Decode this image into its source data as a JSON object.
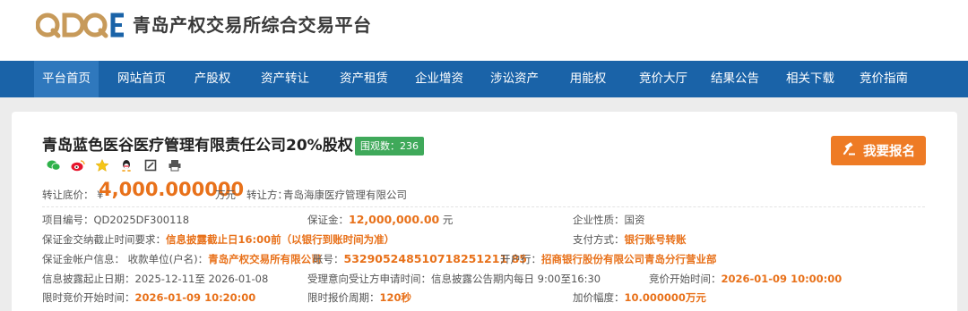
{
  "header": {
    "logo_text": "QDQE",
    "site_title": "青岛产权交易所综合交易平台"
  },
  "colors": {
    "nav_bg": "#1a63a8",
    "nav_active": "#2f78bd",
    "accent": "#ee7b25",
    "badge": "#3fa95a",
    "logo_gold": "#c79a5a",
    "logo_blue": "#1a63a8"
  },
  "nav": {
    "items": [
      {
        "label": "平台首页",
        "active": true
      },
      {
        "label": "网站首页"
      },
      {
        "label": "产股权"
      },
      {
        "label": "资产转让"
      },
      {
        "label": "资产租赁"
      },
      {
        "label": "企业增资"
      },
      {
        "label": "涉讼资产"
      },
      {
        "label": "用能权"
      },
      {
        "label": "竞价大厅"
      },
      {
        "label": "结果公告"
      },
      {
        "label": "相关下载"
      },
      {
        "label": "竞价指南"
      }
    ]
  },
  "project": {
    "title": "青岛蓝色医谷医疗管理有限责任公司20%股权",
    "views_label": "围观数：",
    "views": "236",
    "share_icons": [
      "wechat-icon",
      "weibo-icon",
      "star-icon",
      "qq-icon",
      "edit-icon",
      "print-icon"
    ],
    "register_label": "我要报名",
    "price_label": "转让底价：",
    "currency": "¥",
    "price": "4,000.000000",
    "price_unit": "万元",
    "transferor_label": "转让方：",
    "transferor": "青岛海康医疗管理有限公司"
  },
  "details": {
    "project_no_label": "项目编号：",
    "project_no": "QD2025DF300118",
    "deposit_label": "保证金：",
    "deposit": "12,000,000.00",
    "deposit_unit": "元",
    "company_nature_label": "企业性质：",
    "company_nature": "国资",
    "deposit_deadline_label": "保证金交纳截止时间要求：",
    "deposit_deadline": "信息披露截止日16:00前（以银行到账时间为准）",
    "payment_label": "支付方式：",
    "payment": "银行账号转账",
    "account_name_label": "保证金帐户信息：  收款单位(户名)：",
    "account_name": "青岛产权交易所有限公司",
    "account_no_label": "账号：",
    "account_no": "532905248510718251211 85",
    "bank_label": "开户行：",
    "bank": "招商银行股份有限公司青岛分行营业部",
    "disclosure_label": "信息披露起止日期：",
    "disclosure": "2025-12-11至 2026-01-08",
    "accept_time_label": "受理意向受让方申请时间：",
    "accept_time": "信息披露公告期内每日 9:00至16:30",
    "bid_start_label": "竞价开始时间：",
    "bid_start": "2026-01-09 10:00:00",
    "limit_start_label": "限时竞价开始时间：",
    "limit_start": "2026-01-09 10:20:00",
    "limit_period_label": "限时报价周期：",
    "limit_period": "120秒",
    "increment_label": "加价幅度：",
    "increment": "10.000000万元"
  }
}
